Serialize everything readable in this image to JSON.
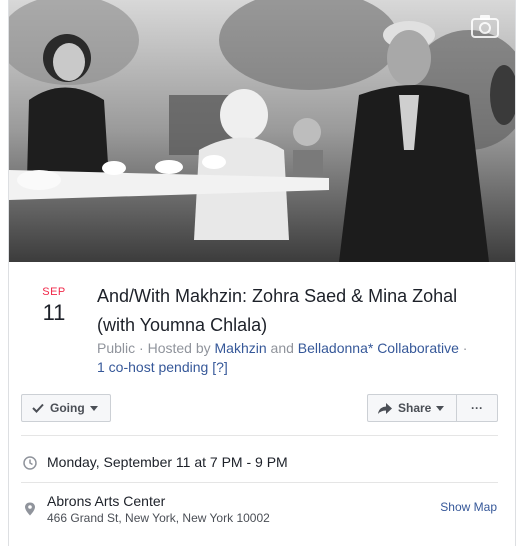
{
  "event": {
    "month": "SEP",
    "day": "11",
    "title": "And/With Makhzin: Zohra Saed & Mina Zohal (with Youmna Chlala)",
    "privacy": "Public",
    "hosted_by_prefix": "· Hosted by",
    "host1": "Makhzin",
    "and": "and",
    "host2": "Belladonna* Collaborative",
    "separator": "·",
    "cohost_pending": "1 co-host pending [?]"
  },
  "actions": {
    "going_label": "Going",
    "share_label": "Share",
    "more_label": "···"
  },
  "details": {
    "datetime": "Monday, September 11 at 7 PM - 9 PM",
    "location_name": "Abrons Arts Center",
    "location_address": "466 Grand St, New York, New York 10002",
    "show_map": "Show Map"
  },
  "icons": {
    "cover_camera": "camera-icon",
    "going_check": "check-icon",
    "share_arrow": "share-arrow-icon",
    "time": "clock-icon",
    "location": "map-pin-icon"
  }
}
